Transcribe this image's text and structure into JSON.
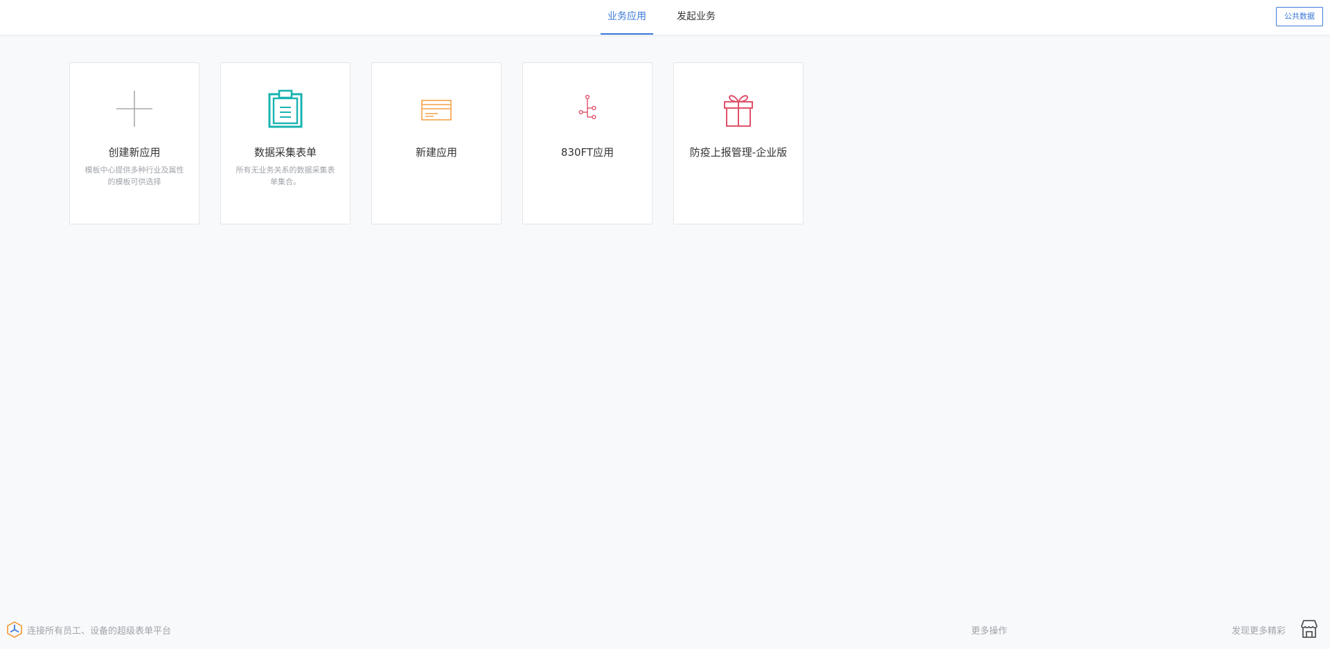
{
  "header": {
    "tabs": [
      {
        "label": "业务应用",
        "active": true
      },
      {
        "label": "发起业务",
        "active": false
      }
    ],
    "public_data_label": "公共数据"
  },
  "cards": [
    {
      "title": "创建新应用",
      "desc": "模板中心提供多种行业及属性的模板可供选择",
      "icon": "plus-icon",
      "color": "#a8a8a8"
    },
    {
      "title": "数据采集表单",
      "desc": "所有无业务关系的数据采集表单集合。",
      "icon": "clipboard-icon",
      "color": "#17b3b0"
    },
    {
      "title": "新建应用",
      "desc": "",
      "icon": "card-icon",
      "color": "#f5a146"
    },
    {
      "title": "830FT应用",
      "desc": "",
      "icon": "flow-icon",
      "color": "#e0506a"
    },
    {
      "title": "防疫上报管理-企业版",
      "desc": "",
      "icon": "gift-icon",
      "color": "#e0506a"
    }
  ],
  "footer": {
    "slogan": "连接所有员工、设备的超级表单平台",
    "more_ops": "更多操作",
    "discover": "发现更多精彩",
    "store_icon": "store-icon"
  },
  "colors": {
    "accent": "#3a78d8",
    "logo_orange": "#f5a146",
    "logo_blue": "#3a78d8"
  }
}
